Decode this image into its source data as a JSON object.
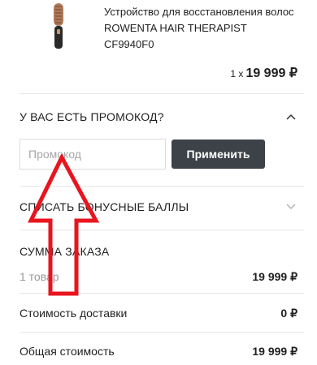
{
  "product": {
    "title": "Устройство для восстановления волос ROWENTA HAIR THERAPIST CF9940F0",
    "quantity": "1 х",
    "price": "19 999 ₽"
  },
  "promo": {
    "heading": "У ВАС ЕСТЬ ПРОМОКОД?",
    "placeholder": "Промокод",
    "apply_label": "Применить"
  },
  "bonus": {
    "heading": "СПИСАТЬ БОНУСНЫЕ БАЛЛЫ"
  },
  "summary": {
    "heading": "СУММА ЗАКАЗА",
    "items_label": "1 товар",
    "items_value": "19 999 ₽",
    "delivery_label": "Стоимость доставки",
    "delivery_value": "0 ₽",
    "total_label": "Общая стоимость",
    "total_value": "19 999 ₽"
  },
  "icons": {
    "promo_toggle": "chevron-up-icon",
    "bonus_toggle": "chevron-down-icon"
  },
  "colors": {
    "button_bg": "#3d4248",
    "annotation_arrow": "#e8141e"
  }
}
